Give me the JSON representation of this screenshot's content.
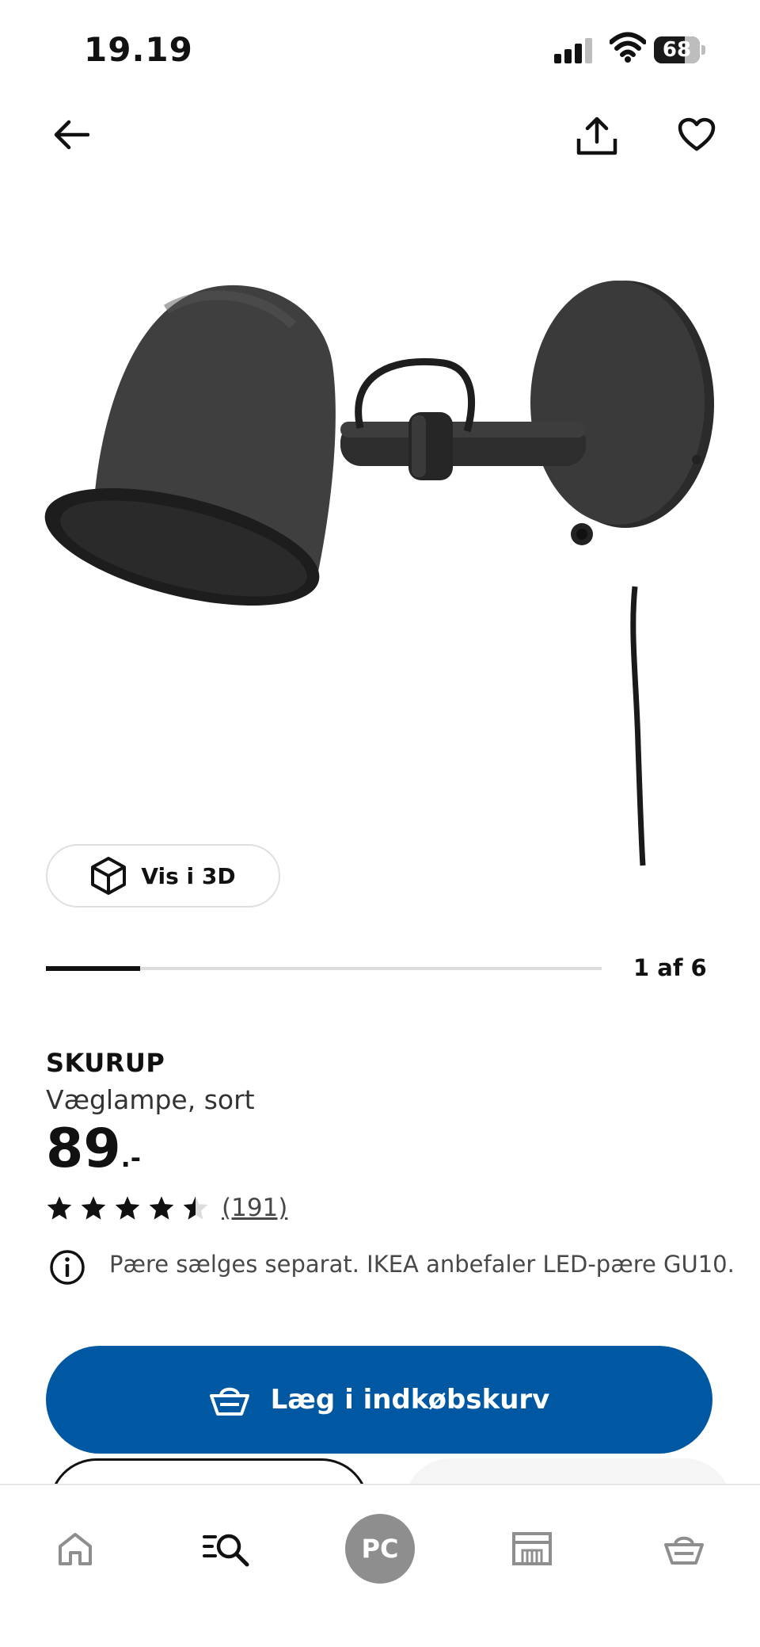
{
  "status_bar": {
    "time": "19.19",
    "battery": "68"
  },
  "header": {
    "back_icon": "arrow-left-icon",
    "share_icon": "share-icon",
    "favorite_icon": "heart-icon"
  },
  "gallery": {
    "view_3d_label": "Vis i 3D",
    "page_indicator": "1 af 6",
    "progress": 0.17
  },
  "product": {
    "name": "SKURUP",
    "description": "Væglampe, sort",
    "price_int": "89",
    "price_suffix": ".-",
    "rating": 4.5,
    "review_count": "(191)",
    "info_text": "Pære sælges separat. IKEA anbefaler LED-pære GU10."
  },
  "actions": {
    "add_to_cart_label": "Læg i indkøbskurv"
  },
  "bottom_nav": {
    "items": [
      {
        "icon": "home-icon"
      },
      {
        "icon": "search-icon"
      },
      {
        "icon": "avatar",
        "label": "PC"
      },
      {
        "icon": "store-icon"
      },
      {
        "icon": "basket-icon"
      }
    ]
  },
  "colors": {
    "primary_blue": "#0058a3",
    "text": "#111111",
    "muted": "#484848"
  }
}
